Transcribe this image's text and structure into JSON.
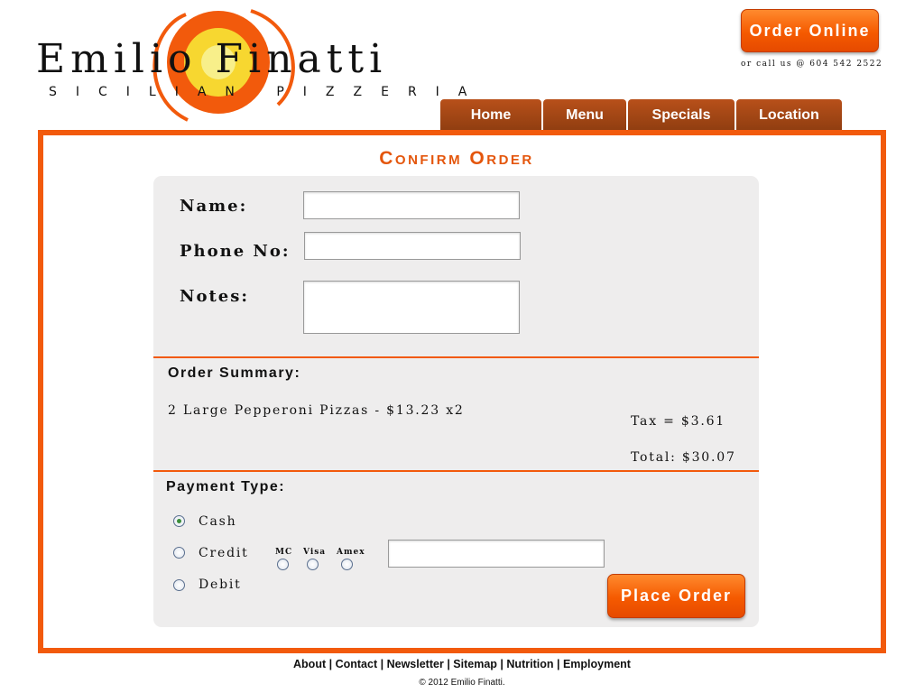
{
  "logo": {
    "title": "Emilio Finatti",
    "subtitle": "Sicilian Pizzeria",
    "colors": {
      "ring": "#f25a0c",
      "sun": "#f7d730"
    }
  },
  "header": {
    "order_online_label": "Order Online",
    "call_us": "or call us @ 604 542 2522"
  },
  "nav": {
    "tabs": [
      {
        "label": "Home"
      },
      {
        "label": "Menu"
      },
      {
        "label": "Specials"
      },
      {
        "label": "Location"
      }
    ]
  },
  "page": {
    "title": "Confirm Order"
  },
  "form": {
    "name_label": "Name:",
    "name_value": "",
    "phone_label": "Phone No:",
    "phone_value": "",
    "notes_label": "Notes:",
    "notes_value": ""
  },
  "summary": {
    "heading": "Order Summary:",
    "item": "2 Large Pepperoni Pizzas - $13.23 x2",
    "tax": "Tax =   $3.61",
    "total": "Total: $30.07"
  },
  "payment": {
    "heading": "Payment Type:",
    "options": [
      {
        "label": "Cash",
        "selected": true
      },
      {
        "label": "Credit",
        "selected": false
      },
      {
        "label": "Debit",
        "selected": false
      }
    ],
    "cards": [
      "MC",
      "Visa",
      "Amex"
    ],
    "card_number_value": "",
    "place_order_label": "Place Order"
  },
  "footer": {
    "links": [
      "About",
      "Contact",
      "Newsletter",
      "Sitemap",
      "Nutrition",
      "Employment"
    ],
    "copyright": "© 2012 Emilio Finatti."
  },
  "colors": {
    "accent": "#f25a0c",
    "tab": "#8e3d10",
    "panel": "#eeeded"
  }
}
